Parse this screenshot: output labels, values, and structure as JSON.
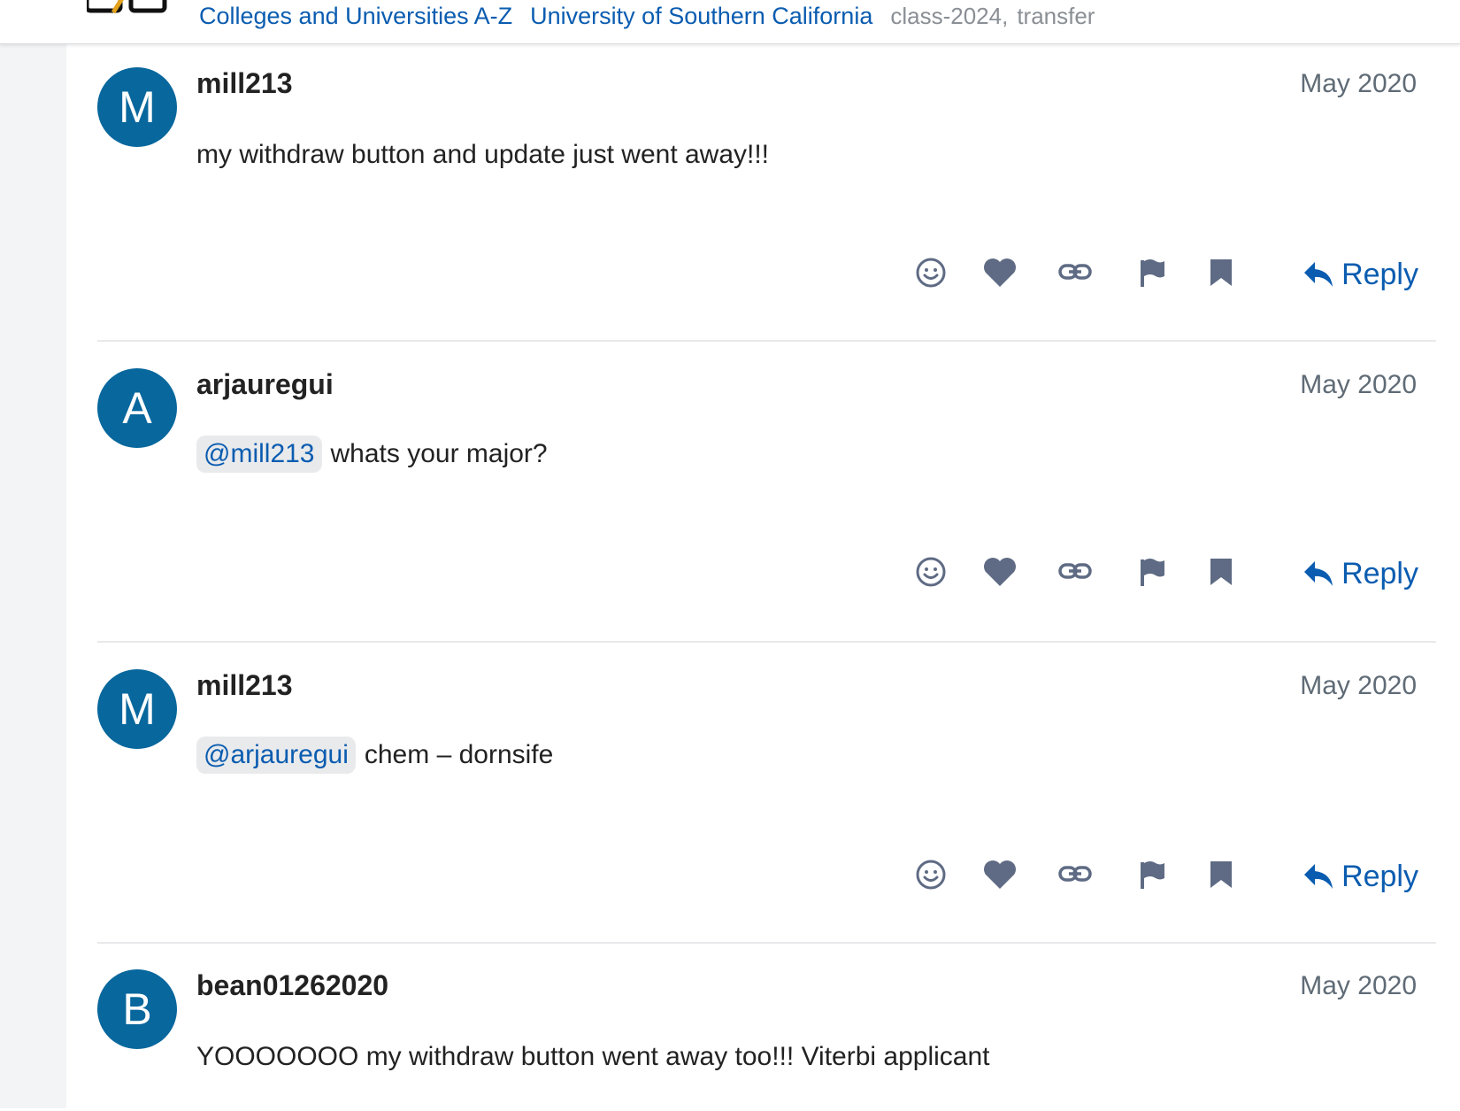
{
  "header": {
    "breadcrumbs": [
      {
        "label": "Colleges and Universities A-Z"
      },
      {
        "label": "University of Southern California"
      }
    ],
    "tags": [
      "class-2024",
      "transfer"
    ],
    "tag_separator": ","
  },
  "actions": {
    "reply_label": "Reply",
    "icons": [
      "emoji-icon",
      "heart-icon",
      "link-icon",
      "flag-icon",
      "bookmark-icon"
    ]
  },
  "posts": [
    {
      "avatar_letter": "M",
      "username": "mill213",
      "date": "May 2020",
      "mention": "",
      "text": "my withdraw button and update just went away!!!"
    },
    {
      "avatar_letter": "A",
      "username": "arjauregui",
      "date": "May 2020",
      "mention": "@mill213",
      "text": "whats your major?"
    },
    {
      "avatar_letter": "M",
      "username": "mill213",
      "date": "May 2020",
      "mention": "@arjauregui",
      "text": "chem – dornsife"
    },
    {
      "avatar_letter": "B",
      "username": "bean01262020",
      "date": "May 2020",
      "mention": "",
      "text": "YOOOOOOO my withdraw button went away too!!! Viterbi applicant"
    }
  ],
  "colors": {
    "avatar": "#08679d",
    "link": "#0a5cb0",
    "icon": "#5f6b84",
    "muted": "#5f6b76"
  }
}
